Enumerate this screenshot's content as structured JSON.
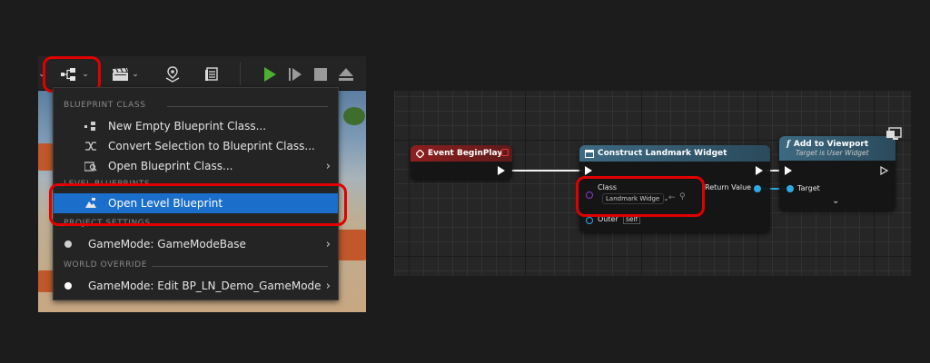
{
  "toolbar": {
    "icons": [
      "blueprints-dropdown-icon",
      "cinematics-dropdown-icon",
      "platforms-icon",
      "build-icon",
      "play-icon",
      "skip-icon",
      "stop-icon",
      "eject-icon"
    ]
  },
  "menu": {
    "sections": {
      "blueprint_class": "BLUEPRINT CLASS",
      "level_blueprints": "LEVEL BLUEPRINTS",
      "project_settings": "PROJECT SETTINGS",
      "world_override": "WORLD OVERRIDE"
    },
    "items": {
      "new_empty": "New Empty Blueprint Class...",
      "convert_selection": "Convert Selection to Blueprint Class...",
      "open_bp_class": "Open Blueprint Class...",
      "open_level_bp": "Open Level Blueprint",
      "gamemode_project": "GameMode: GameModeBase",
      "gamemode_world": "GameMode: Edit BP_LN_Demo_GameMode"
    }
  },
  "graph": {
    "event_node": {
      "title": "Event BeginPlay"
    },
    "construct_node": {
      "title": "Construct Landmark Widget",
      "class_label": "Class",
      "class_value": "Landmark Widge",
      "return_label": "Return Value",
      "outer_label": "Outer",
      "outer_value": "self"
    },
    "viewport_node": {
      "title": "Add to Viewport",
      "subtitle": "Target is User Widget",
      "target_label": "Target"
    }
  },
  "colors": {
    "highlight": "#e00000",
    "selected": "#1b6fcb",
    "event_header": "#8e1f1f",
    "function_header": "#3d6a82",
    "pin_blue": "#2fa9e6",
    "play_green": "#4caf31"
  }
}
